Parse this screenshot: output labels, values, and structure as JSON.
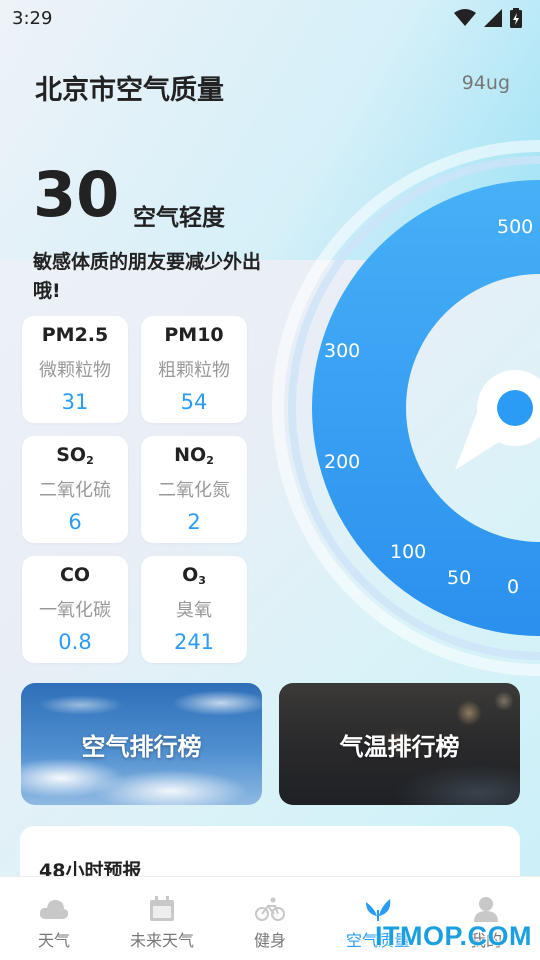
{
  "status_bar": {
    "time": "3:29"
  },
  "header": {
    "title": "北京市空气质量",
    "value": "94ug"
  },
  "aqi": {
    "number": "30",
    "level": "空气轻度",
    "advice": "敏感体质的朋友要减少外出哦!"
  },
  "gauge": {
    "ticks": [
      "500",
      "300",
      "200",
      "100",
      "50",
      "0"
    ],
    "accent": "#2b9cf5"
  },
  "pollutants": [
    {
      "name": "PM2.5",
      "sub": "",
      "desc": "微颗粒物",
      "value": "31"
    },
    {
      "name": "PM10",
      "sub": "",
      "desc": "粗颗粒物",
      "value": "54"
    },
    {
      "name": "SO",
      "sub": "2",
      "desc": "二氧化硫",
      "value": "6"
    },
    {
      "name": "NO",
      "sub": "2",
      "desc": "二氧化氮",
      "value": "2"
    },
    {
      "name": "CO",
      "sub": "",
      "desc": "一氧化碳",
      "value": "0.8"
    },
    {
      "name": "O",
      "sub": "3",
      "desc": "臭氧",
      "value": "241"
    }
  ],
  "banners": {
    "air_ranking": "空气排行榜",
    "temp_ranking": "气温排行榜"
  },
  "forecast": {
    "title": "48小时预报"
  },
  "nav": [
    {
      "label": "天气",
      "icon": "cloud-icon"
    },
    {
      "label": "未来天气",
      "icon": "calendar-icon"
    },
    {
      "label": "健身",
      "icon": "bicycle-icon"
    },
    {
      "label": "空气质量",
      "icon": "leaf-icon"
    },
    {
      "label": "我的",
      "icon": "user-icon"
    }
  ],
  "watermark": "ITMOP.COM"
}
